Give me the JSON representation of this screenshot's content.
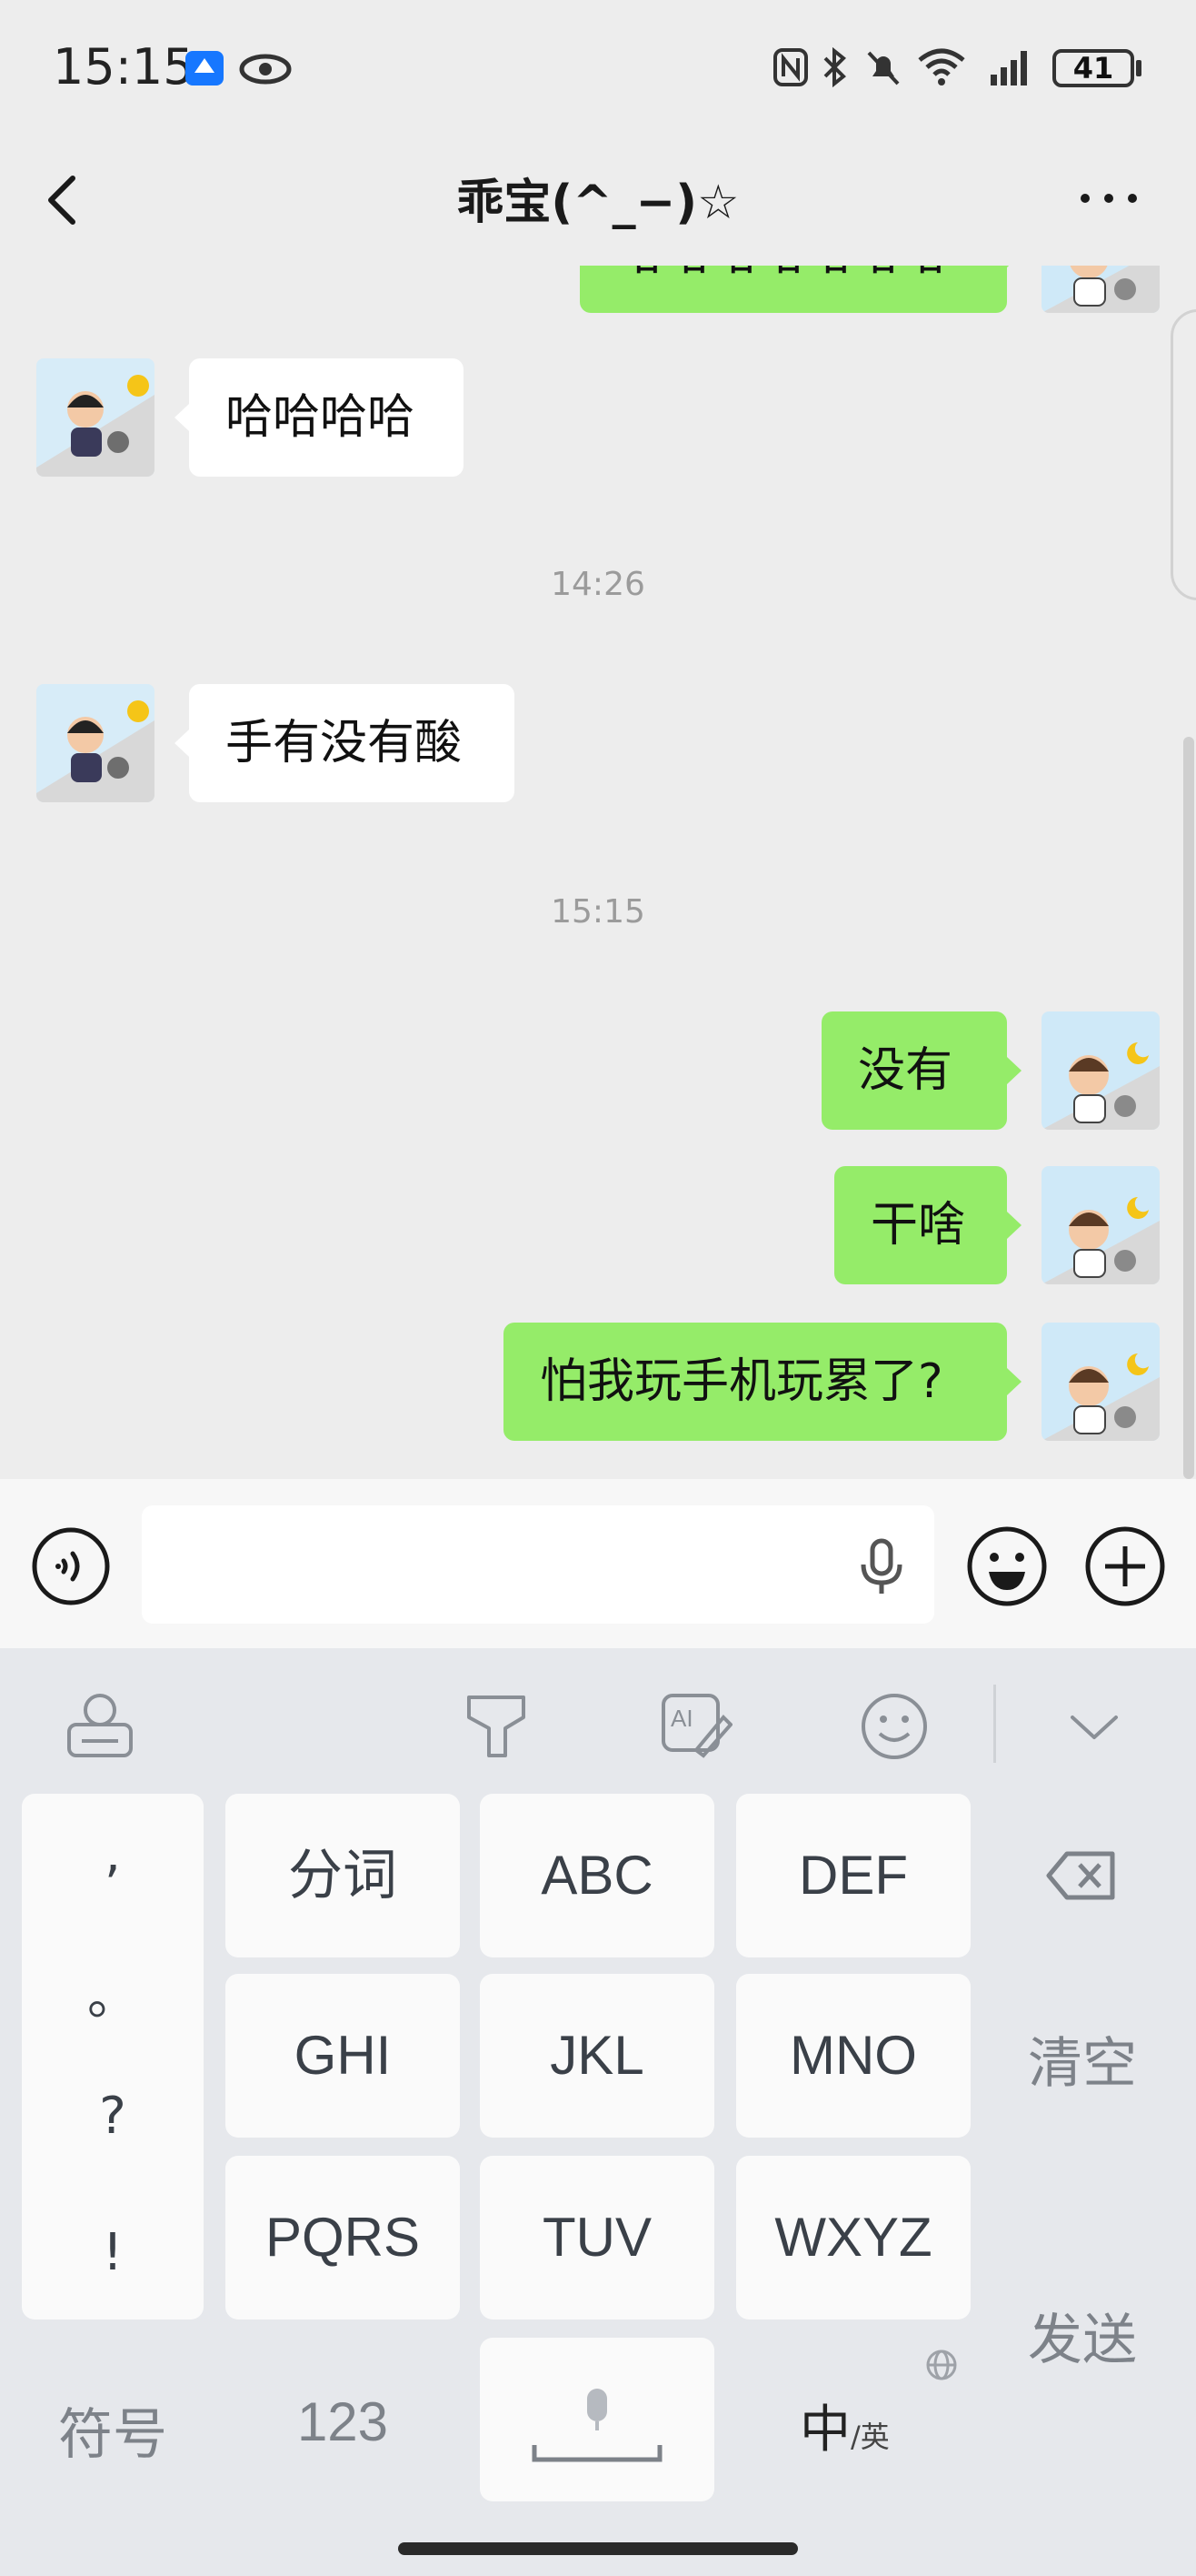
{
  "status_bar": {
    "time": "15:15",
    "battery": "41"
  },
  "header": {
    "title": "乖宝(^_−)☆"
  },
  "messages": [
    {
      "side": "right",
      "text": "哈哈哈哈哈哈哈"
    },
    {
      "side": "left",
      "text": "哈哈哈哈"
    },
    {
      "type": "time",
      "text": "14:26"
    },
    {
      "side": "left",
      "text": "手有没有酸"
    },
    {
      "type": "time",
      "text": "15:15"
    },
    {
      "side": "right",
      "text": "没有"
    },
    {
      "side": "right",
      "text": "干啥"
    },
    {
      "side": "right",
      "text": "怕我玩手机玩累了?"
    }
  ],
  "input": {
    "placeholder": ""
  },
  "keyboard": {
    "punct": [
      ",",
      "。",
      "?",
      "!"
    ],
    "keys": {
      "k1": "分词",
      "k2": "ABC",
      "k3": "DEF",
      "k4": "GHI",
      "k5": "JKL",
      "k6": "MNO",
      "k7": "PQRS",
      "k8": "TUV",
      "k9": "WXYZ"
    },
    "clear": "清空",
    "send": "发送",
    "symbols": "符号",
    "numbers": "123",
    "lang_main": "中",
    "lang_sub": "/英"
  },
  "colors": {
    "bubble_right": "#95ec69",
    "bubble_left": "#ffffff",
    "background": "#ededed"
  }
}
